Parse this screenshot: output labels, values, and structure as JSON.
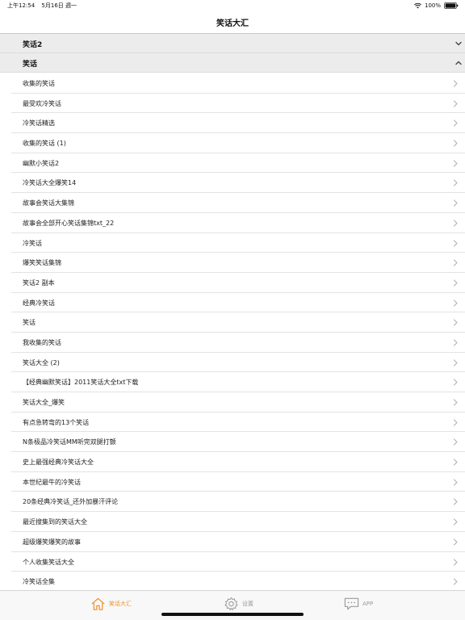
{
  "status_bar": {
    "time": "上午12:54",
    "date": "5月16日 週一",
    "battery": "100%"
  },
  "nav": {
    "title": "笑话大汇"
  },
  "sections": [
    {
      "title": "笑话2",
      "expanded": false
    },
    {
      "title": "笑话",
      "expanded": true
    }
  ],
  "items": [
    "收集的笑话",
    "最受欢冷笑话",
    "冷笑话精选",
    "收集的笑话 (1)",
    "幽默小笑话2",
    "冷笑话大全爆笑14",
    "故事会笑话大集锦",
    "故事会全部开心笑话集锦txt_22",
    "冷笑话",
    "爆笑笑话集锦",
    "笑话2 副本",
    "经典冷笑话",
    "笑话",
    "我收集的笑话",
    "笑话大全 (2)",
    "【经典幽默笑话】2011笑话大全txt下载",
    "笑话大全_爆笑",
    "有点急转弯的13个笑话",
    "N条极品冷笑话MM听完双腿打颤",
    "史上最强经典冷笑话大全",
    "本世纪最牛的冷笑话",
    "20条经典冷笑话_还外加暴汗评论",
    "最近搜集到的笑话大全",
    "超级爆笑爆笑的故事",
    "个人收集笑话大全",
    "冷笑话全集"
  ],
  "tabs": [
    {
      "label": "笑话大汇",
      "icon": "home-icon",
      "active": true
    },
    {
      "label": "设置",
      "icon": "gear-icon",
      "active": false
    },
    {
      "label": "APP",
      "icon": "chat-bubble-icon",
      "active": false
    }
  ],
  "colors": {
    "accent": "#f0932b",
    "inactive": "#9a9a9a",
    "section_bg": "#ececec"
  }
}
